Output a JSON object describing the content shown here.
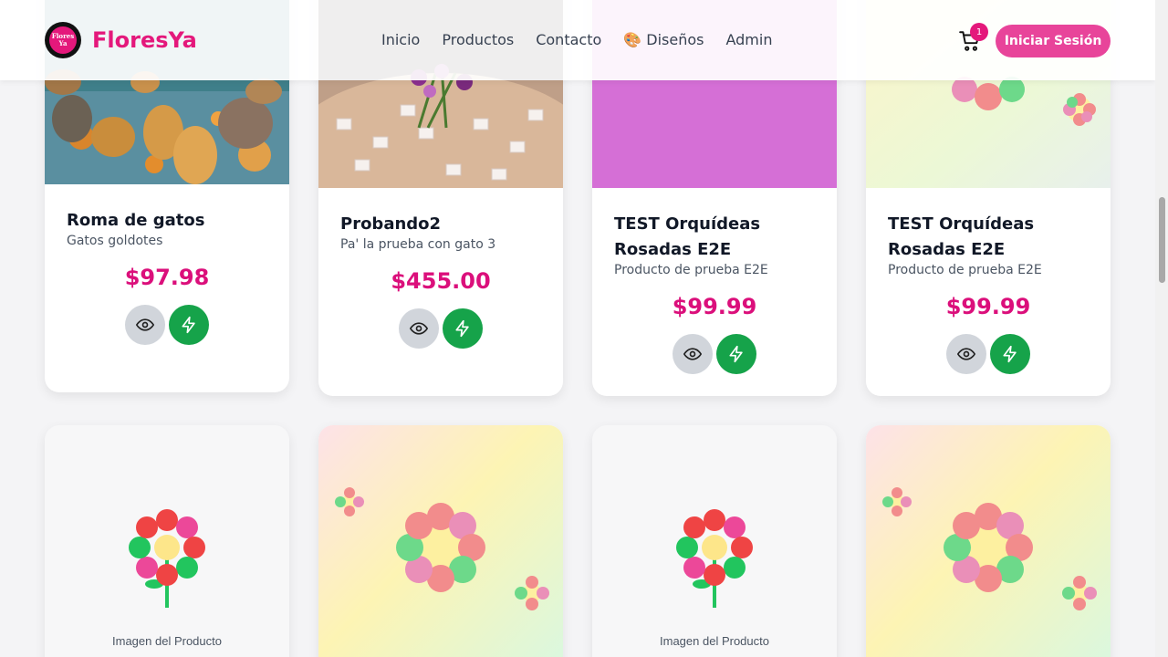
{
  "brand": {
    "name": "FloresYa",
    "logo_text": "Flores Ya"
  },
  "nav": {
    "items": [
      "Inicio",
      "Productos",
      "Contacto",
      "🎨 Diseños",
      "Admin"
    ]
  },
  "cart": {
    "count": "1",
    "icon": "cart-icon"
  },
  "auth": {
    "login_label": "Iniciar Sesión"
  },
  "products": [
    {
      "title": "Roma de gatos",
      "desc": "Gatos goldotes",
      "price": "$97.98"
    },
    {
      "title": "Probando2",
      "desc": "Pa' la prueba con gato 3",
      "price": "$455.00"
    },
    {
      "title": "TEST Orquídeas Rosadas E2E",
      "desc": "Producto de prueba E2E",
      "price": "$99.99"
    },
    {
      "title": "TEST Orquídeas Rosadas E2E",
      "desc": "Producto de prueba E2E",
      "price": "$99.99"
    }
  ],
  "placeholders": {
    "label": "Imagen del Producto"
  },
  "icons": {
    "view": "eye-icon",
    "add": "cart-icon",
    "buy": "lightning-icon"
  },
  "colors": {
    "accent": "#e4187b",
    "buy": "#16a34a",
    "view": "#d1d5db",
    "product_purple": "#d56fd6"
  }
}
